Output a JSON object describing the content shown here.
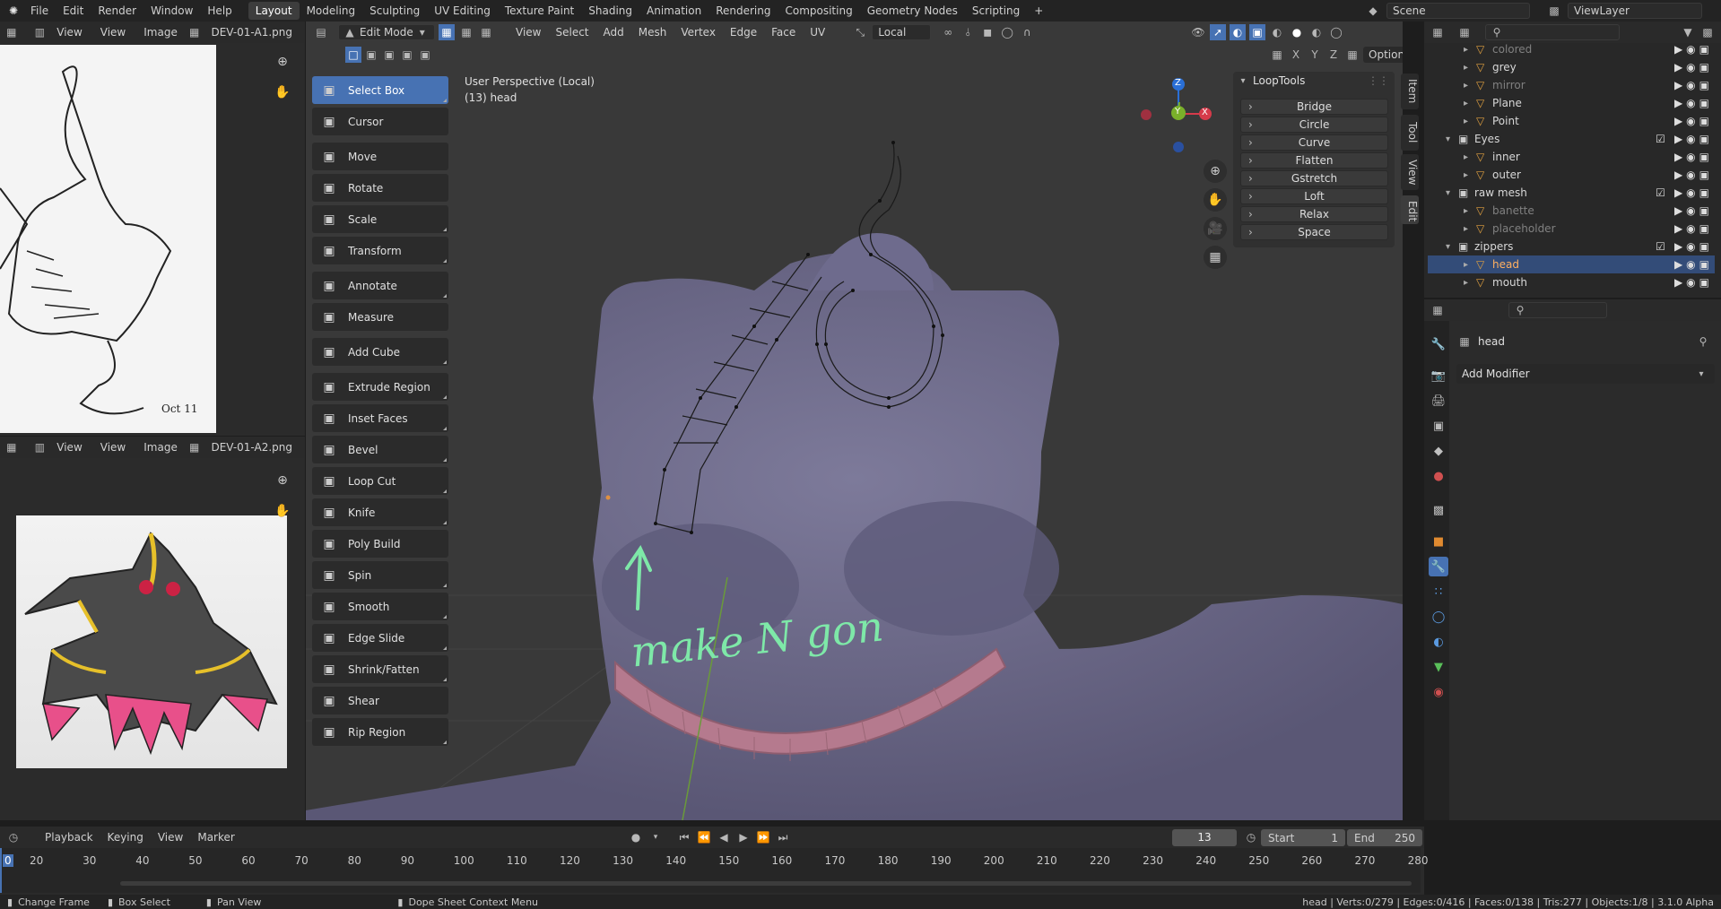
{
  "topbar": {
    "menus": [
      "File",
      "Edit",
      "Render",
      "Window",
      "Help"
    ],
    "workspaces": [
      "Layout",
      "Modeling",
      "Sculpting",
      "UV Editing",
      "Texture Paint",
      "Shading",
      "Animation",
      "Rendering",
      "Compositing",
      "Geometry Nodes",
      "Scripting"
    ],
    "active_workspace": "Layout",
    "add_tab": "+",
    "scene": "Scene",
    "view_layer": "ViewLayer"
  },
  "image_editor_top": {
    "view": "View",
    "view2": "View",
    "image": "Image",
    "filename": "DEV-01-A1.png"
  },
  "image_editor_bottom": {
    "view": "View",
    "view2": "View",
    "image": "Image",
    "filename": "DEV-01-A2.png"
  },
  "viewport_header": {
    "mode": "Edit Mode",
    "menus": [
      "View",
      "Select",
      "Add",
      "Mesh",
      "Vertex",
      "Edge",
      "Face",
      "UV"
    ],
    "transform_orientation": "Local",
    "axes": [
      "X",
      "Y",
      "Z"
    ],
    "options": "Options"
  },
  "viewport": {
    "perspective": "User Perspective (Local)",
    "object_info": "(13) head",
    "annotation_text": "make N gon",
    "gizmo_labels": {
      "z": "Z",
      "y": "Y",
      "x": "X"
    }
  },
  "toolbar": {
    "tools": [
      {
        "label": "Select Box",
        "icon": "select-box-icon"
      },
      {
        "label": "Cursor",
        "icon": "cursor-icon"
      },
      {
        "label": "Move",
        "icon": "move-icon"
      },
      {
        "label": "Rotate",
        "icon": "rotate-icon"
      },
      {
        "label": "Scale",
        "icon": "scale-icon"
      },
      {
        "label": "Transform",
        "icon": "transform-icon"
      },
      {
        "label": "Annotate",
        "icon": "annotate-icon"
      },
      {
        "label": "Measure",
        "icon": "measure-icon"
      },
      {
        "label": "Add Cube",
        "icon": "add-cube-icon"
      },
      {
        "label": "Extrude Region",
        "icon": "extrude-icon"
      },
      {
        "label": "Inset Faces",
        "icon": "inset-icon"
      },
      {
        "label": "Bevel",
        "icon": "bevel-icon"
      },
      {
        "label": "Loop Cut",
        "icon": "loop-cut-icon"
      },
      {
        "label": "Knife",
        "icon": "knife-icon"
      },
      {
        "label": "Poly Build",
        "icon": "poly-build-icon"
      },
      {
        "label": "Spin",
        "icon": "spin-icon"
      },
      {
        "label": "Smooth",
        "icon": "smooth-icon"
      },
      {
        "label": "Edge Slide",
        "icon": "edge-slide-icon"
      },
      {
        "label": "Shrink/Fatten",
        "icon": "shrink-icon"
      },
      {
        "label": "Shear",
        "icon": "shear-icon"
      },
      {
        "label": "Rip Region",
        "icon": "rip-icon"
      }
    ]
  },
  "looptools": {
    "title": "LoopTools",
    "items": [
      "Bridge",
      "Circle",
      "Curve",
      "Flatten",
      "Gstretch",
      "Loft",
      "Relax",
      "Space"
    ],
    "side_tabs": [
      "Item",
      "Tool",
      "View",
      "Edit"
    ]
  },
  "outliner": {
    "rows": [
      {
        "label": "colored",
        "indent": 2,
        "dim": true
      },
      {
        "label": "grey",
        "indent": 2,
        "dim": false
      },
      {
        "label": "mirror",
        "indent": 2,
        "dim": true
      },
      {
        "label": "Plane",
        "indent": 2,
        "dim": false
      },
      {
        "label": "Point",
        "indent": 2,
        "dim": false
      },
      {
        "label": "Eyes",
        "indent": 1,
        "dim": false
      },
      {
        "label": "inner",
        "indent": 2,
        "dim": false
      },
      {
        "label": "outer",
        "indent": 2,
        "dim": false
      },
      {
        "label": "raw mesh",
        "indent": 1,
        "dim": false
      },
      {
        "label": "banette",
        "indent": 2,
        "dim": true
      },
      {
        "label": "placeholder",
        "indent": 2,
        "dim": true
      },
      {
        "label": "zippers",
        "indent": 1,
        "dim": false
      },
      {
        "label": "head",
        "indent": 2,
        "dim": false,
        "selected": true
      },
      {
        "label": "mouth",
        "indent": 2,
        "dim": false
      }
    ]
  },
  "properties": {
    "object_name": "head",
    "add_modifier": "Add Modifier"
  },
  "timeline": {
    "menus": [
      "Playback",
      "Keying",
      "View",
      "Marker"
    ],
    "current_frame": "13",
    "start_label": "Start",
    "start": "1",
    "end_label": "End",
    "end": "250",
    "ticks": [
      "0",
      "20",
      "30",
      "40",
      "50",
      "60",
      "70",
      "80",
      "90",
      "100",
      "110",
      "120",
      "130",
      "140",
      "150",
      "160",
      "170",
      "180",
      "190",
      "200",
      "210",
      "220",
      "230",
      "240",
      "250",
      "260",
      "270",
      "280"
    ]
  },
  "statusbar": {
    "change_frame": "Change Frame",
    "box_select": "Box Select",
    "pan_view": "Pan View",
    "context_menu": "Dope Sheet Context Menu",
    "stats": "head | Verts:0/279 | Edges:0/416 | Faces:0/138 | Tris:277 | Objects:1/8 | 3.1.0 Alpha"
  },
  "colors": {
    "accent": "#4772b3",
    "mesh": "#6b6888",
    "annotation": "#7ee8a8",
    "selected_row": "#334c78"
  }
}
